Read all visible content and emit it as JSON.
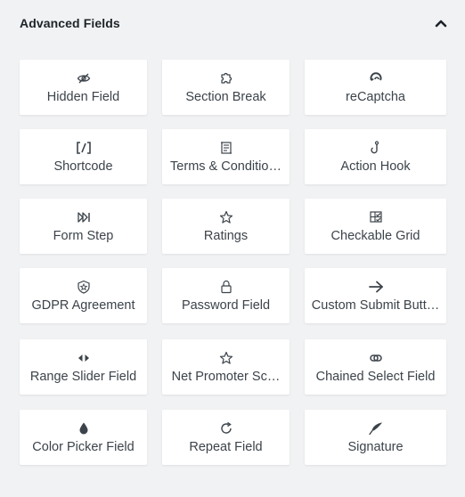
{
  "panel": {
    "title": "Advanced Fields",
    "collapse_icon": "chevron-up-icon"
  },
  "fields": [
    {
      "label": "Hidden Field",
      "icon": "eye-slash-icon"
    },
    {
      "label": "Section Break",
      "icon": "puzzle-icon"
    },
    {
      "label": "reCaptcha",
      "icon": "recaptcha-icon"
    },
    {
      "label": "Shortcode",
      "icon": "shortcode-icon"
    },
    {
      "label": "Terms & Conditio…",
      "icon": "scroll-icon"
    },
    {
      "label": "Action Hook",
      "icon": "hook-icon"
    },
    {
      "label": "Form Step",
      "icon": "step-forward-icon"
    },
    {
      "label": "Ratings",
      "icon": "star-icon"
    },
    {
      "label": "Checkable Grid",
      "icon": "checklist-icon"
    },
    {
      "label": "GDPR Agreement",
      "icon": "shield-icon"
    },
    {
      "label": "Password Field",
      "icon": "lock-icon"
    },
    {
      "label": "Custom Submit Butt…",
      "icon": "arrow-right-icon"
    },
    {
      "label": "Range Slider Field",
      "icon": "range-arrows-icon"
    },
    {
      "label": "Net Promoter Sc…",
      "icon": "star-icon"
    },
    {
      "label": "Chained Select Field",
      "icon": "link-icon"
    },
    {
      "label": "Color Picker Field",
      "icon": "droplet-icon"
    },
    {
      "label": "Repeat Field",
      "icon": "repeat-icon"
    },
    {
      "label": "Signature",
      "icon": "feather-icon"
    }
  ]
}
